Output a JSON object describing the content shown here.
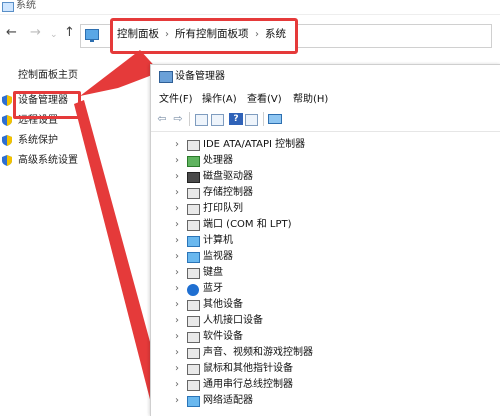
{
  "window": {
    "title": "系统"
  },
  "nav": {
    "back": "←",
    "forward": "→",
    "dropdown": "⌄",
    "up": "↑"
  },
  "breadcrumbs": [
    "控制面板",
    "所有控制面板项",
    "系统"
  ],
  "breadcrumb_separator": "›",
  "left_panel": {
    "home": "控制面板主页",
    "items": [
      "设备管理器",
      "远程设置",
      "系统保护",
      "高级系统设置"
    ]
  },
  "device_manager": {
    "title": "设备管理器",
    "menu": [
      "文件(F)",
      "操作(A)",
      "查看(V)",
      "帮助(H)"
    ],
    "toolbar": {
      "back": "⇦",
      "forward": "⇨",
      "help": "?"
    },
    "tree": [
      {
        "label": "IDE ATA/ATAPI 控制器",
        "icon": "ide-controller-icon"
      },
      {
        "label": "处理器",
        "icon": "processor-icon"
      },
      {
        "label": "磁盘驱动器",
        "icon": "disk-drive-icon"
      },
      {
        "label": "存储控制器",
        "icon": "storage-controller-icon"
      },
      {
        "label": "打印队列",
        "icon": "printer-icon"
      },
      {
        "label": "端口 (COM 和 LPT)",
        "icon": "port-icon"
      },
      {
        "label": "计算机",
        "icon": "computer-icon"
      },
      {
        "label": "监视器",
        "icon": "monitor-icon"
      },
      {
        "label": "键盘",
        "icon": "keyboard-icon"
      },
      {
        "label": "蓝牙",
        "icon": "bluetooth-icon"
      },
      {
        "label": "其他设备",
        "icon": "other-devices-icon"
      },
      {
        "label": "人机接口设备",
        "icon": "hid-icon"
      },
      {
        "label": "软件设备",
        "icon": "software-device-icon"
      },
      {
        "label": "声音、视频和游戏控制器",
        "icon": "sound-icon"
      },
      {
        "label": "鼠标和其他指针设备",
        "icon": "mouse-icon"
      },
      {
        "label": "通用串行总线控制器",
        "icon": "usb-icon"
      },
      {
        "label": "网络适配器",
        "icon": "network-adapter-icon"
      }
    ]
  },
  "colors": {
    "highlight": "#e53a3a",
    "accent": "#2b75b8"
  }
}
